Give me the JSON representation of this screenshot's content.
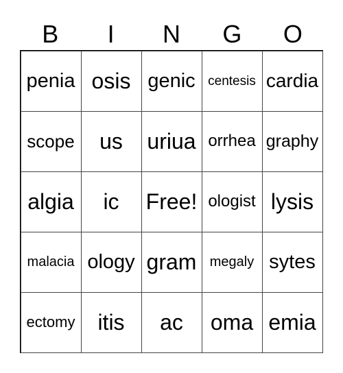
{
  "header": [
    "B",
    "I",
    "N",
    "G",
    "O"
  ],
  "cells": [
    [
      "penia",
      "osis",
      "genic",
      "centesis",
      "cardia"
    ],
    [
      "scope",
      "us",
      "uriua",
      "orrhea",
      "graphy"
    ],
    [
      "algia",
      "ic",
      "Free!",
      "ologist",
      "lysis"
    ],
    [
      "malacia",
      "ology",
      "gram",
      "megaly",
      "sytes"
    ],
    [
      "ectomy",
      "itis",
      "ac",
      "oma",
      "emia"
    ]
  ]
}
